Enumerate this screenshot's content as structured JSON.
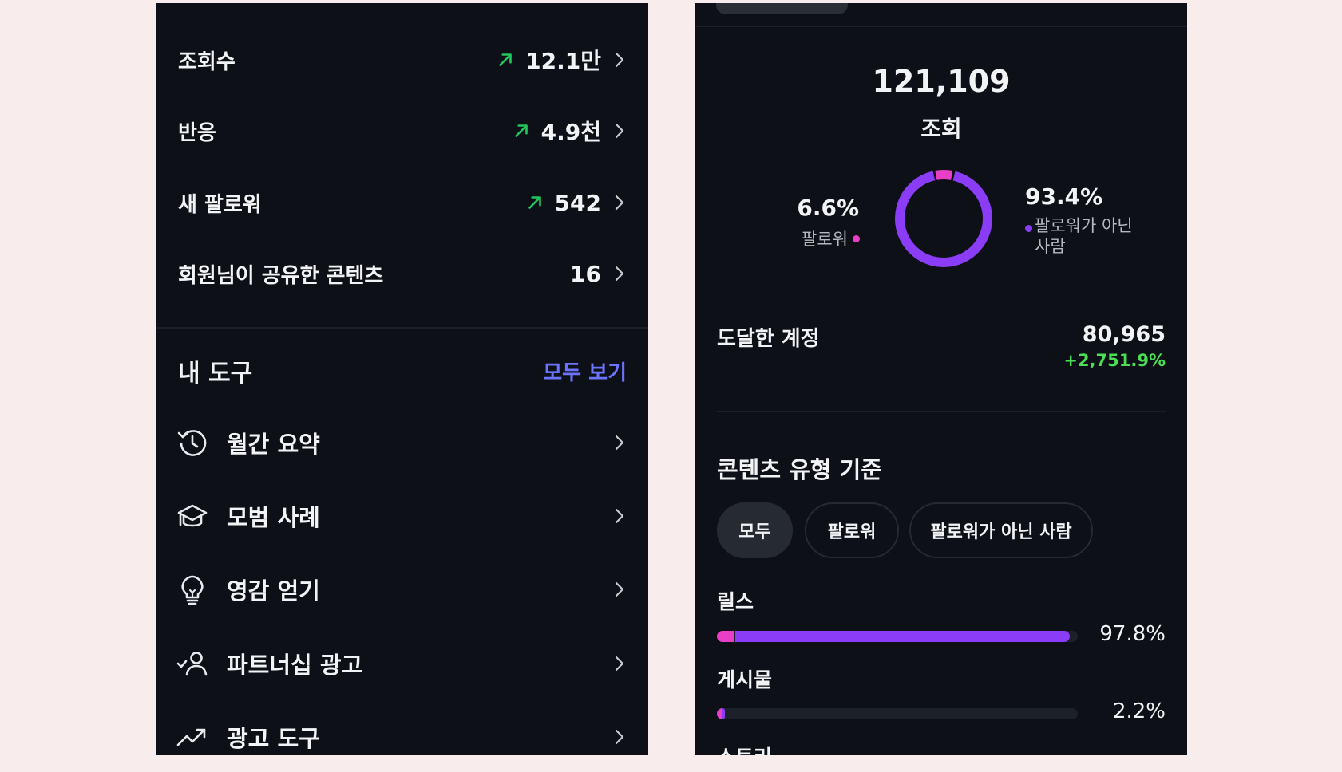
{
  "colors": {
    "background": "#f8ecec",
    "panel": "#0d1016",
    "trend_up": "#22c55e",
    "link_blue": "#6c73ff",
    "follower_pink": "#e83fc6",
    "nonfollower_purple": "#8a3cf6",
    "reach_change_green": "#4ade55"
  },
  "left_panel": {
    "stats": [
      {
        "label": "조회수",
        "value": "12.1만",
        "trend": "up",
        "trend_icon": "arrow-up-right-icon"
      },
      {
        "label": "반응",
        "value": "4.9천",
        "trend": "up",
        "trend_icon": "arrow-up-right-icon"
      },
      {
        "label": "새 팔로워",
        "value": "542",
        "trend": "up",
        "trend_icon": "arrow-up-right-icon"
      },
      {
        "label": "회원님이 공유한 콘텐츠",
        "value": "16",
        "trend": "none"
      }
    ],
    "tools": {
      "title": "내 도구",
      "see_all": "모두 보기",
      "items": [
        {
          "label": "월간 요약",
          "icon": "history-icon"
        },
        {
          "label": "모범 사례",
          "icon": "graduation-cap-icon"
        },
        {
          "label": "영감 얻기",
          "icon": "lightbulb-icon"
        },
        {
          "label": "파트너십 광고",
          "icon": "verified-person-icon"
        },
        {
          "label": "광고 도구",
          "icon": "trending-up-icon"
        }
      ]
    }
  },
  "right_panel": {
    "total_views": "121,109",
    "total_views_label": "조회",
    "followers": {
      "percent": "6.6%",
      "label": "팔로워",
      "share": 0.066
    },
    "non_followers": {
      "percent": "93.4%",
      "label_line1": "팔로워가 아닌",
      "label_line2": "사람",
      "share": 0.934
    },
    "reach": {
      "label": "도달한 계정",
      "value": "80,965",
      "change": "+2,751.9%"
    },
    "content_type": {
      "title": "콘텐츠 유형 기준",
      "filters": [
        {
          "label": "모두",
          "selected": true
        },
        {
          "label": "팔로워",
          "selected": false
        },
        {
          "label": "팔로워가 아닌 사람",
          "selected": false
        }
      ],
      "items": [
        {
          "label": "릴스",
          "percent": "97.8%",
          "value": 0.978,
          "follower_share": 0.05
        },
        {
          "label": "게시물",
          "percent": "2.2%",
          "value": 0.022,
          "follower_share": 0.6
        },
        {
          "label": "스토리"
        }
      ]
    }
  }
}
